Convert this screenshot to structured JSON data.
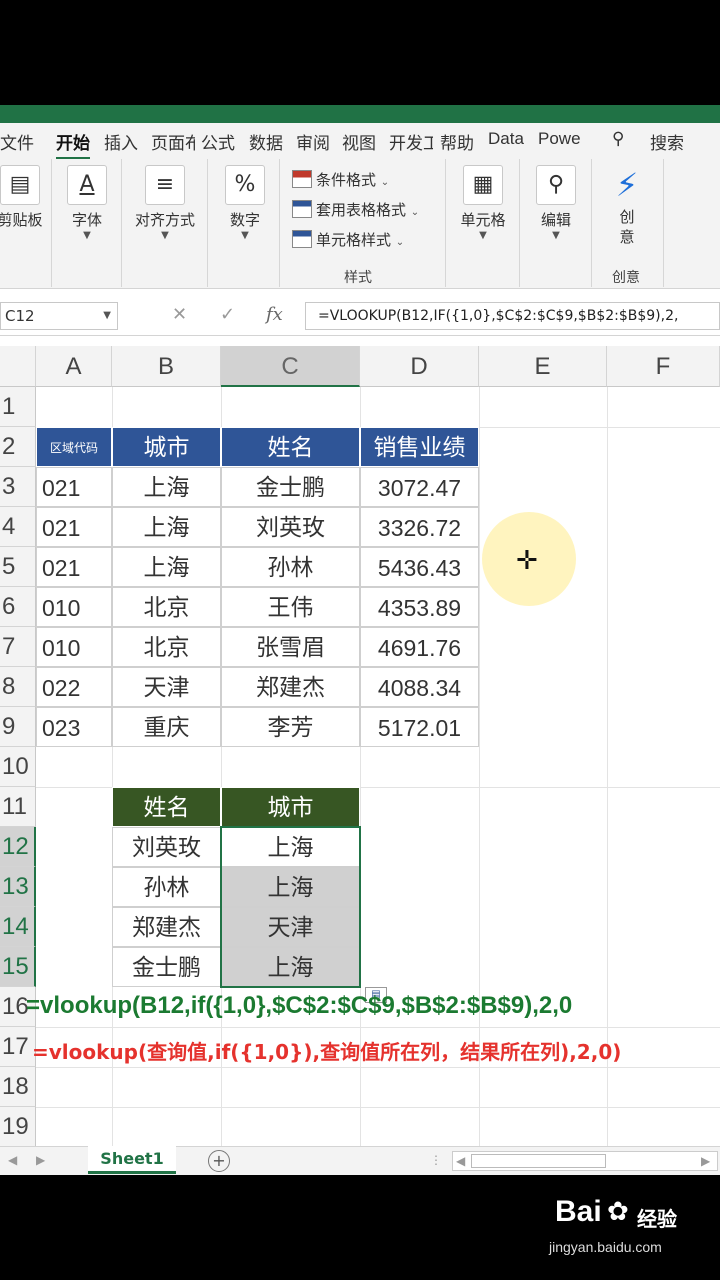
{
  "ribbon": {
    "tabs": [
      "文件",
      "开始",
      "插入",
      "页面布",
      "公式",
      "数据",
      "审阅",
      "视图",
      "开发工",
      "帮助",
      "Data",
      "Powe"
    ],
    "search_label": "搜索",
    "clipboard_label": "剪贴板",
    "font_label": "字体",
    "align_label": "对齐方式",
    "number_label": "数字",
    "styles": {
      "conditional": "条件格式",
      "table_format": "套用表格格式",
      "cell_style": "单元格样式",
      "group_label": "样式"
    },
    "cells_label": "单元格",
    "edit_label": "编辑",
    "create_label": "创意",
    "create_btn": "创\n意"
  },
  "formula_bar": {
    "name_box": "C12",
    "formula": "=VLOOKUP(B12,IF({1,0},$C$2:$C$9,$B$2:$B$9),2,"
  },
  "sheet": {
    "columns": [
      "A",
      "B",
      "C",
      "D",
      "E",
      "F"
    ],
    "rows": [
      "1",
      "2",
      "3",
      "4",
      "5",
      "6",
      "7",
      "8",
      "9",
      "10",
      "11",
      "12",
      "13",
      "14",
      "15",
      "16",
      "17",
      "18",
      "19"
    ],
    "table1": {
      "headers": [
        "区域代码",
        "城市",
        "姓名",
        "销售业绩"
      ],
      "rows": [
        [
          "021",
          "上海",
          "金士鹏",
          "3072.47"
        ],
        [
          "021",
          "上海",
          "刘英玫",
          "3326.72"
        ],
        [
          "021",
          "上海",
          "孙林",
          "5436.43"
        ],
        [
          "010",
          "北京",
          "王伟",
          "4353.89"
        ],
        [
          "010",
          "北京",
          "张雪眉",
          "4691.76"
        ],
        [
          "022",
          "天津",
          "郑建杰",
          "4088.34"
        ],
        [
          "023",
          "重庆",
          "李芳",
          "5172.01"
        ]
      ]
    },
    "table2": {
      "headers": [
        "姓名",
        "城市"
      ],
      "rows": [
        [
          "刘英玫",
          "上海"
        ],
        [
          "孙林",
          "上海"
        ],
        [
          "郑建杰",
          "天津"
        ],
        [
          "金士鹏",
          "上海"
        ]
      ]
    },
    "formula_green": "=vlookup(B12,if({1,0},$C$2:$C$9,$B$2:$B$9),2,0",
    "formula_red": "=vlookup(查询值,if({1,0}),查询值所在列，结果所在列),2,0)"
  },
  "sheet_tab": "Sheet1",
  "watermark": {
    "logo": "Bai",
    "cn": "经验",
    "url": "jingyan.baidu.com"
  },
  "colors": {
    "excel_green": "#217346",
    "header_blue": "#2f5597",
    "header_green": "#375623",
    "formula_green": "#1b7a31",
    "formula_red": "#e5322d"
  }
}
